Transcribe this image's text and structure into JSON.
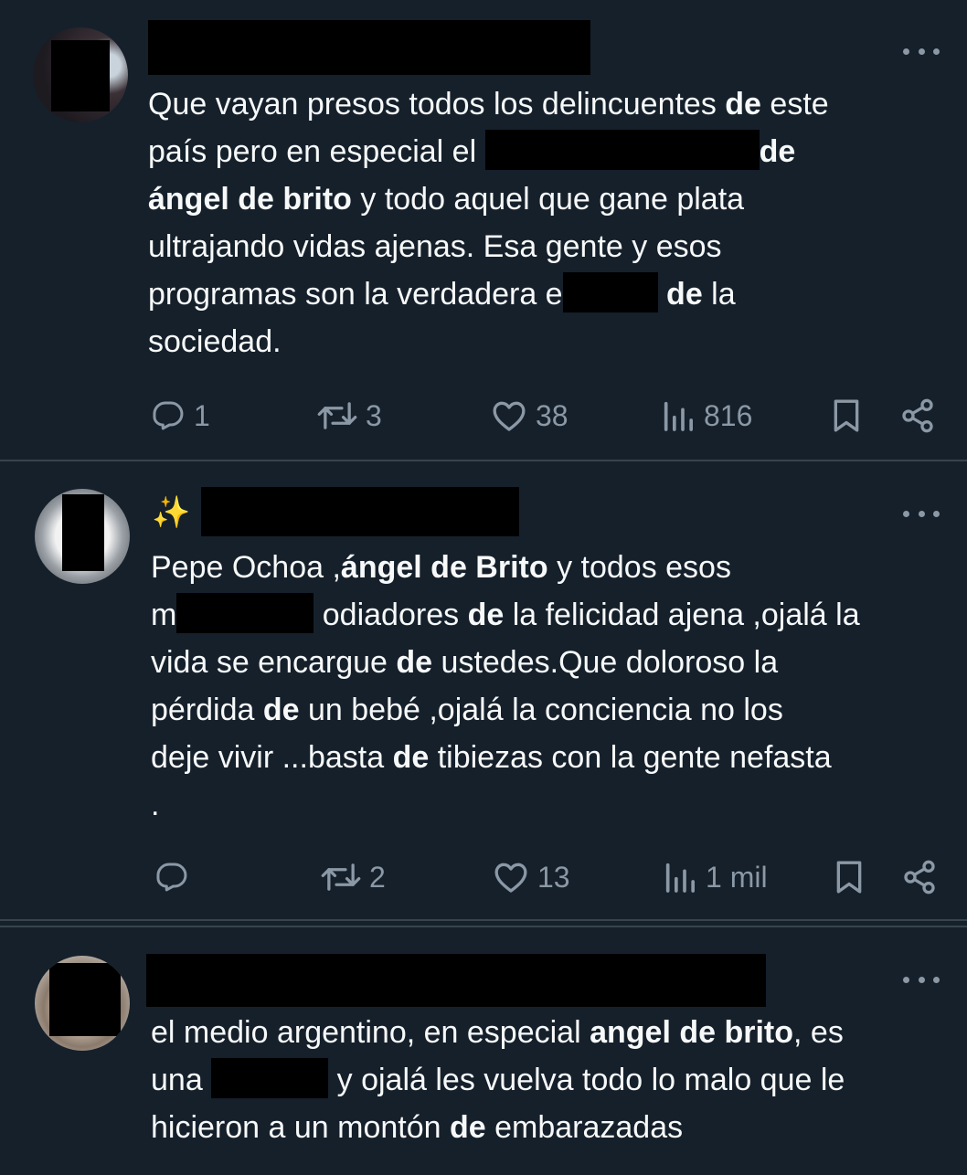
{
  "tweets": [
    {
      "lines": [
        [
          {
            "t": "Que vayan presos todos los delincuentes "
          },
          {
            "t": "de",
            "b": true
          },
          {
            "t": " este"
          }
        ],
        [
          {
            "t": "país pero en especial el "
          },
          {
            "redact": 300
          },
          {
            "t": "de",
            "b": true
          }
        ],
        [
          {
            "t": "ángel de brito",
            "b": true
          },
          {
            "t": " y todo aquel que gane plata"
          }
        ],
        [
          {
            "t": "ultrajando vidas ajenas. Esa gente y esos"
          }
        ],
        [
          {
            "t": "programas son la verdadera e"
          },
          {
            "redact": 104
          },
          {
            "t": " "
          },
          {
            "t": "de",
            "b": true
          },
          {
            "t": " la"
          }
        ],
        [
          {
            "t": "sociedad."
          }
        ]
      ],
      "stats": {
        "replies": "1",
        "retweets": "3",
        "likes": "38",
        "views": "816"
      }
    },
    {
      "lines": [
        [
          {
            "t": "Pepe Ochoa ,"
          },
          {
            "t": "ángel de Brito",
            "b": true
          },
          {
            "t": " y todos esos"
          }
        ],
        [
          {
            "t": "m"
          },
          {
            "redact": 150
          },
          {
            "t": " odiadores "
          },
          {
            "t": "de",
            "b": true
          },
          {
            "t": " la felicidad ajena ,ojalá la"
          }
        ],
        [
          {
            "t": "vida se encargue "
          },
          {
            "t": "de",
            "b": true
          },
          {
            "t": " ustedes.Que doloroso la"
          }
        ],
        [
          {
            "t": "pérdida "
          },
          {
            "t": "de",
            "b": true
          },
          {
            "t": " un bebé ,ojalá la conciencia no los"
          }
        ],
        [
          {
            "t": "deje vivir ...basta "
          },
          {
            "t": "de",
            "b": true
          },
          {
            "t": " tibiezas con la gente nefasta"
          }
        ],
        [
          {
            "t": "."
          }
        ]
      ],
      "stats": {
        "replies": "",
        "retweets": "2",
        "likes": "13",
        "views": "1 mil"
      }
    },
    {
      "lines": [
        [
          {
            "t": "el medio argentino, en especial "
          },
          {
            "t": "angel de brito",
            "b": true
          },
          {
            "t": ", es"
          }
        ],
        [
          {
            "t": "una "
          },
          {
            "redact": 128
          },
          {
            "t": " y ojalá les vuelva todo lo malo que le"
          }
        ],
        [
          {
            "t": "hicieron a un montón "
          },
          {
            "t": "de",
            "b": true
          },
          {
            "t": " embarazadas"
          }
        ]
      ]
    }
  ],
  "icons": {
    "reply": "reply-icon",
    "retweet": "retweet-icon",
    "like": "heart-icon",
    "views": "views-icon",
    "bookmark": "bookmark-icon",
    "share": "share-icon",
    "more": "more-icon",
    "sparkle": "✨"
  },
  "colors": {
    "background": "#15202b",
    "text": "#f7f9f9",
    "muted": "#8b98a5",
    "divider": "#38444d"
  }
}
